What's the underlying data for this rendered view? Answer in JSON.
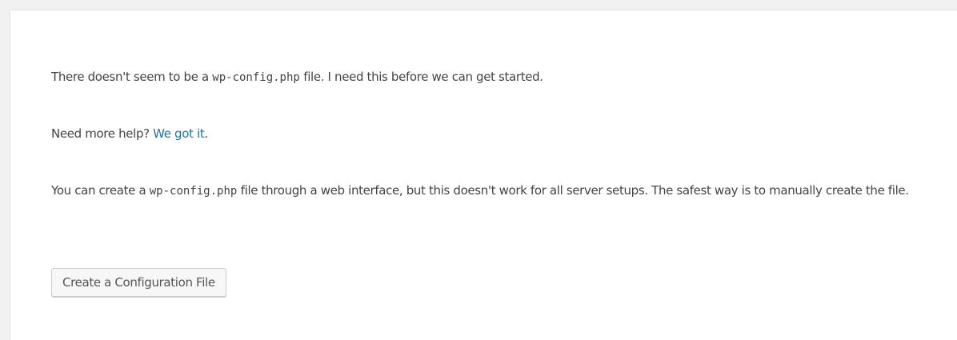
{
  "intro": {
    "before_code": "There doesn't seem to be a ",
    "code": "wp-config.php",
    "after_code": " file. I need this before we can get started."
  },
  "help": {
    "before_link": "Need more help? ",
    "link_text": "We got it",
    "after_link": "."
  },
  "instructions": {
    "before_code": "You can create a ",
    "code": "wp-config.php",
    "after_code": " file through a web interface, but this doesn't work for all server setups. The safest way is to manually create the file."
  },
  "create_button": {
    "label": "Create a Configuration File"
  },
  "colors": {
    "link": "#21759b",
    "text": "#444444",
    "page_background": "#f1f1f1",
    "panel_background": "#ffffff"
  }
}
